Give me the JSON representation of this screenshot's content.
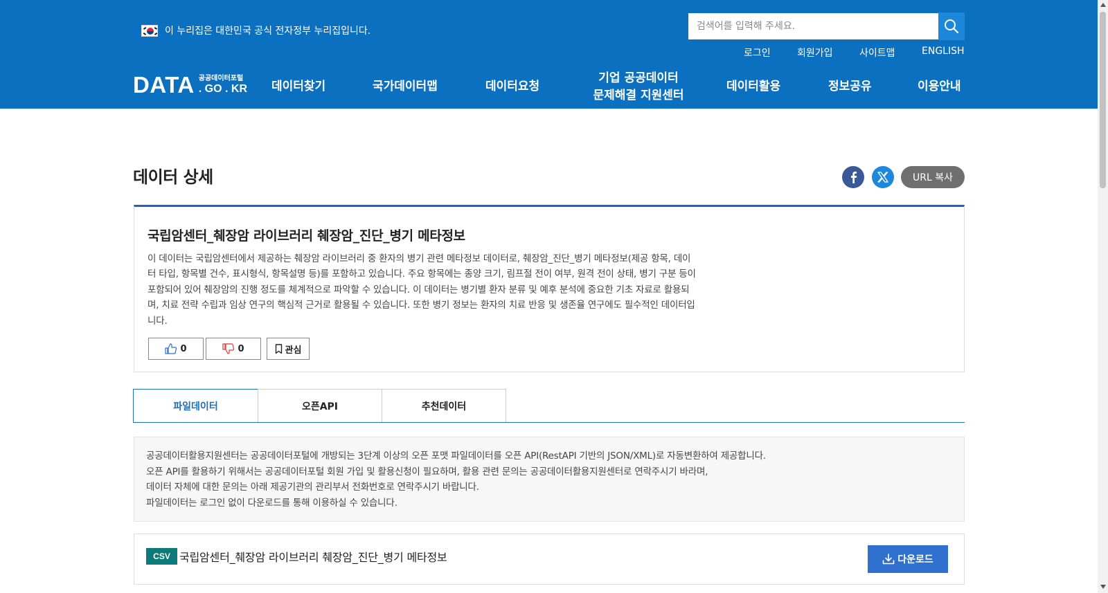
{
  "header": {
    "gov_notice": "이 누리집은 대한민국 공식 전자정부 누리집입니다.",
    "search_placeholder": "검색어를 입력해 주세요.",
    "util_links": [
      "로그인",
      "회원가입",
      "사이트맵",
      "ENGLISH"
    ],
    "logo": {
      "main": "DATA",
      "sub_small": "공공데이터포털",
      "sub_big": ". GO . KR"
    },
    "gnb": [
      "데이터찾기",
      "국가데이터맵",
      "데이터요청",
      "기업 공공데이터",
      "문제해결 지원센터",
      "데이터활용",
      "정보공유",
      "이용안내"
    ]
  },
  "page": {
    "title": "데이터 상세",
    "url_copy_label": "URL 복사"
  },
  "detail": {
    "title": "국립암센터_췌장암 라이브러리 췌장암_진단_병기 메타정보",
    "description": [
      "이 데이터는 국립암센터에서 제공하는 췌장암 라이브러리 중 환자의 병기 관련 메타정보 데이터로, 췌장암_진단_병기 메타정보(제공 항목, 데이",
      "터 타입, 항목별 건수, 표시형식, 항목설명 등)를 포함하고 있습니다. 주요 항목에는 종양 크기, 림프절 전이 여부, 원격 전이 상태, 병기 구분 등이",
      "포함되어 있어 췌장암의 진행 정도를 체계적으로 파악할 수 있습니다. 이 데이터는 병기별 환자 분류 및 예후 분석에 중요한 기초 자료로 활용되",
      "며, 치료 전략 수립과 임상 연구의 핵심적 근거로 활용될 수 있습니다. 또한 병기 정보는 환자의 치료 반응 및 생존율 연구에도 필수적인 데이터입",
      "니다."
    ],
    "like_count": "0",
    "dislike_count": "0",
    "bookmark_label": "관심"
  },
  "tabs": [
    "파일데이터",
    "오픈API",
    "추천데이터"
  ],
  "info": [
    "공공데이터활용지원센터는 공공데이터포털에 개방되는 3단계 이상의 오픈 포맷 파일데이터를 오픈 API(RestAPI 기반의 JSON/XML)로 자동변환하여 제공합니다.",
    "오픈 API를 활용하기 위해서는 공공데이터포털 회원 가입 및 활용신청이 필요하며, 활용 관련 문의는 공공데이터활용지원센터로 연락주시기 바라며,",
    "데이터 자체에 대한 문의는 아래 제공기관의 관리부서 전화번호로 연락주시기 바랍니다.",
    "파일데이터는 로그인 없이 다운로드를 통해 이용하실 수 있습니다."
  ],
  "file": {
    "format": "CSV",
    "title": "국립암센터_췌장암 라이브러리 췌장암_진단_병기 메타정보",
    "download_label": "다운로드"
  },
  "colors": {
    "header_bg": "#0c70c0",
    "accent": "#1d6fc0",
    "download_bg": "#2f6fce",
    "csv_badge": "#0d7a7a"
  }
}
